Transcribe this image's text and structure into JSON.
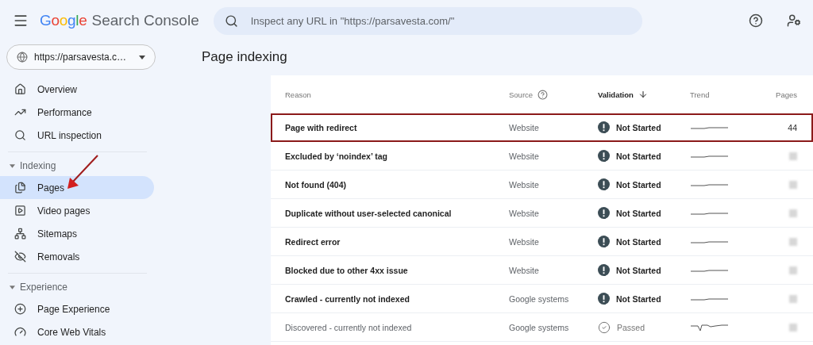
{
  "header": {
    "logo": {
      "brand": "Google",
      "product": "Search Console"
    },
    "search": {
      "placeholder": "Inspect any URL in \"https://parsavesta.com/\""
    }
  },
  "property_selector": {
    "value": "https://parsavesta.c…"
  },
  "sidebar": {
    "sections": [
      {
        "items": [
          {
            "label": "Overview",
            "selected": false
          },
          {
            "label": "Performance",
            "selected": false
          },
          {
            "label": "URL inspection",
            "selected": false
          }
        ]
      },
      {
        "label": "Indexing",
        "expanded": true,
        "items": [
          {
            "label": "Pages",
            "selected": true
          },
          {
            "label": "Video pages",
            "selected": false
          },
          {
            "label": "Sitemaps",
            "selected": false
          },
          {
            "label": "Removals",
            "selected": false
          }
        ]
      },
      {
        "label": "Experience",
        "expanded": true,
        "items": [
          {
            "label": "Page Experience",
            "selected": false
          },
          {
            "label": "Core Web Vitals",
            "selected": false
          }
        ]
      }
    ]
  },
  "page_title": "Page indexing",
  "table": {
    "columns": [
      {
        "label": "Reason",
        "help": false,
        "sorted": false
      },
      {
        "label": "Source",
        "help": true,
        "sorted": false
      },
      {
        "label": "Validation",
        "help": false,
        "sorted": true
      },
      {
        "label": "Trend",
        "help": false,
        "sorted": false
      },
      {
        "label": "Pages",
        "help": false,
        "sorted": false
      }
    ],
    "rows": [
      {
        "reason": "Page with redirect",
        "source": "Website",
        "validation": {
          "kind": "not_started",
          "label": "Not Started"
        },
        "pages": "44",
        "highlighted": true
      },
      {
        "reason": "Excluded by ‘noindex’ tag",
        "source": "Website",
        "validation": {
          "kind": "not_started",
          "label": "Not Started"
        },
        "highlighted": false
      },
      {
        "reason": "Not found (404)",
        "source": "Website",
        "validation": {
          "kind": "not_started",
          "label": "Not Started"
        },
        "highlighted": false
      },
      {
        "reason": "Duplicate without user-selected canonical",
        "source": "Website",
        "validation": {
          "kind": "not_started",
          "label": "Not Started"
        },
        "highlighted": false
      },
      {
        "reason": "Redirect error",
        "source": "Website",
        "validation": {
          "kind": "not_started",
          "label": "Not Started"
        },
        "highlighted": false
      },
      {
        "reason": "Blocked due to other 4xx issue",
        "source": "Website",
        "validation": {
          "kind": "not_started",
          "label": "Not Started"
        },
        "highlighted": false
      },
      {
        "reason": "Crawled - currently not indexed",
        "source": "Google systems",
        "validation": {
          "kind": "not_started",
          "label": "Not Started"
        },
        "highlighted": false
      },
      {
        "reason": "Discovered - currently not indexed",
        "source": "Google systems",
        "validation": {
          "kind": "passed",
          "label": "Passed"
        },
        "highlighted": false
      }
    ]
  }
}
